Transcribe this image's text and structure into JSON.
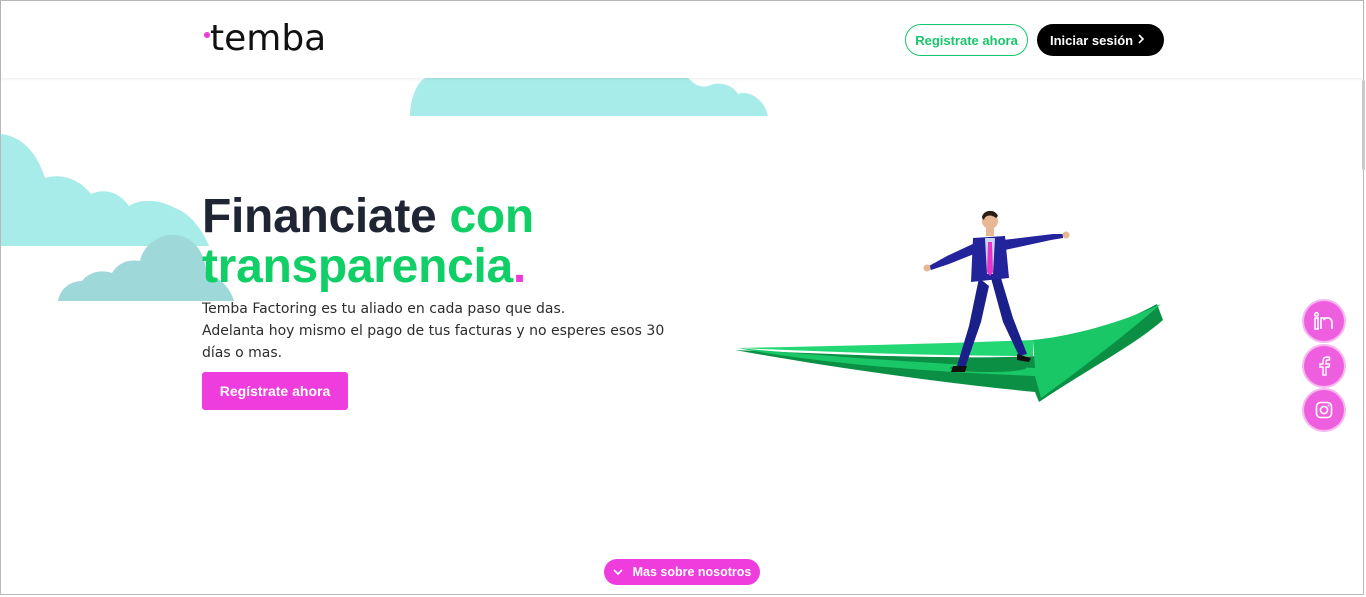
{
  "header": {
    "logo_text": "temba",
    "register_label": "Registrate ahora",
    "login_label": "Iniciar sesión"
  },
  "hero": {
    "title_part1": "Financiate",
    "title_part2": "con",
    "title_part3": "transparencia",
    "title_dot": ".",
    "description_line1": "Temba Factoring es tu aliado en cada paso que das.",
    "description_line2": "Adelanta hoy mismo el pago de tus facturas y no esperes esos 30",
    "description_line3": "días o mas.",
    "cta_label": "Regístrate ahora"
  },
  "social": {
    "items": [
      {
        "icon": "linkedin-icon"
      },
      {
        "icon": "facebook-icon"
      },
      {
        "icon": "instagram-icon"
      }
    ]
  },
  "more": {
    "label": "Mas sobre nosotros"
  },
  "colors": {
    "brand_green": "#0fcf66",
    "brand_pink": "#ee3ddc",
    "cloud_cyan": "#a8ecea",
    "dark": "#1f2533"
  }
}
